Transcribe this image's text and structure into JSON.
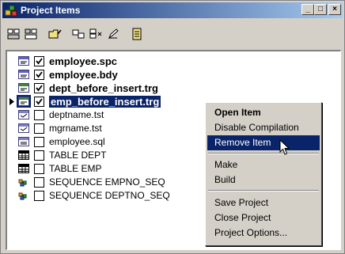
{
  "window": {
    "title": "Project Items",
    "buttons": [
      "_",
      "□",
      "×"
    ]
  },
  "toolbar": {
    "icons": [
      "collapse-icon",
      "expand-icon",
      "open-folder-icon",
      "compile-icon",
      "compile-all-icon",
      "edit-icon",
      "properties-icon"
    ]
  },
  "items": [
    {
      "label": "employee.spc",
      "checked": true,
      "bold": true,
      "icon": "package-spec-icon"
    },
    {
      "label": "employee.bdy",
      "checked": true,
      "bold": true,
      "icon": "package-body-icon"
    },
    {
      "label": "dept_before_insert.trg",
      "checked": true,
      "bold": true,
      "icon": "trigger-icon"
    },
    {
      "label": "emp_before_insert.trg",
      "checked": true,
      "bold": true,
      "icon": "trigger-icon",
      "selected": true
    },
    {
      "label": "deptname.tst",
      "checked": false,
      "bold": false,
      "icon": "test-script-icon"
    },
    {
      "label": "mgrname.tst",
      "checked": false,
      "bold": false,
      "icon": "test-script-icon"
    },
    {
      "label": "employee.sql",
      "checked": false,
      "bold": false,
      "icon": "sql-file-icon"
    },
    {
      "label": "TABLE DEPT",
      "checked": false,
      "bold": false,
      "icon": "table-icon"
    },
    {
      "label": "TABLE EMP",
      "checked": false,
      "bold": false,
      "icon": "table-icon"
    },
    {
      "label": "SEQUENCE EMPNO_SEQ",
      "checked": false,
      "bold": false,
      "icon": "sequence-icon"
    },
    {
      "label": "SEQUENCE DEPTNO_SEQ",
      "checked": false,
      "bold": false,
      "icon": "sequence-icon"
    }
  ],
  "context_menu": {
    "open_item": "Open Item",
    "disable_compilation": "Disable Compilation",
    "remove_item": "Remove Item",
    "make": "Make",
    "build": "Build",
    "save_project": "Save Project",
    "close_project": "Close Project",
    "project_options": "Project Options..."
  },
  "colors": {
    "selection": "#0a246a",
    "face": "#d4d0c8"
  }
}
